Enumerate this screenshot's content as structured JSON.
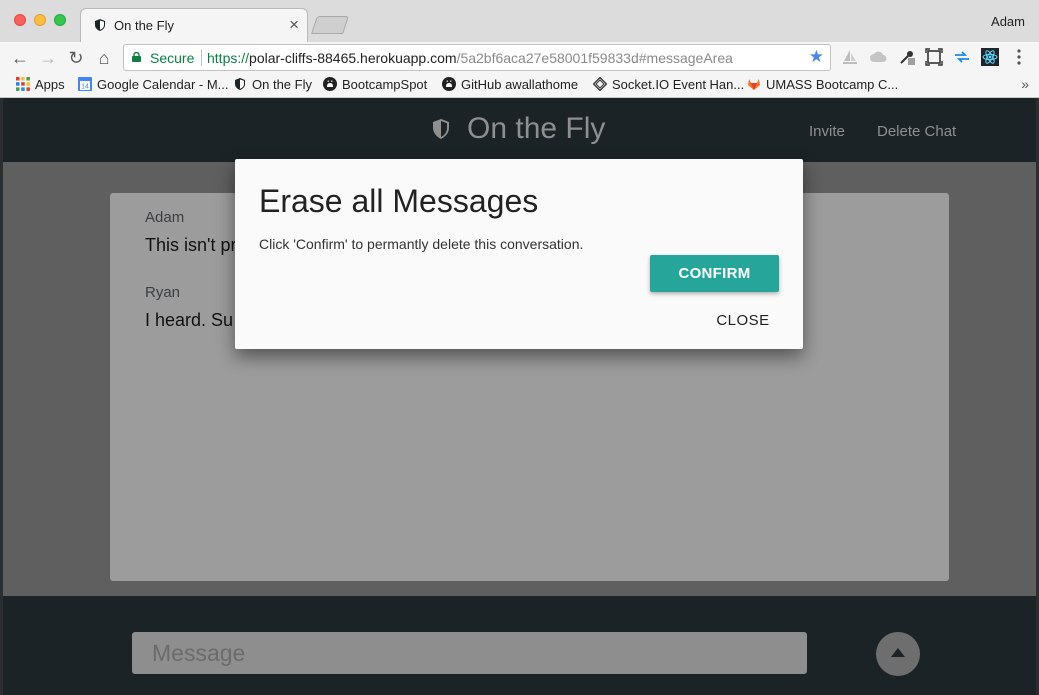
{
  "browser": {
    "tab": {
      "title": "On the Fly",
      "close_glyph": "×"
    },
    "profile_name": "Adam",
    "nav": {
      "back": "←",
      "forward": "→",
      "reload": "↻",
      "home": "⌂"
    },
    "omnibox": {
      "secure_label": "Secure",
      "url_protocol": "https://",
      "url_host": "polar-cliffs-88465.herokuapp.com",
      "url_path": "/5a2bf6aca27e58001f59833d#messageArea",
      "bookmark_star": "★"
    },
    "bookmarks": [
      {
        "label": "Apps",
        "icon": "apps-grid-icon"
      },
      {
        "label": "Google Calendar - M...",
        "icon": "calendar-icon"
      },
      {
        "label": "On the Fly",
        "icon": "shield-icon"
      },
      {
        "label": "BootcampSpot",
        "icon": "github-icon"
      },
      {
        "label": "GitHub awallathome",
        "icon": "github-icon"
      },
      {
        "label": "Socket.IO Event Han...",
        "icon": "socketio-icon"
      },
      {
        "label": "UMASS Bootcamp C...",
        "icon": "gitlab-icon"
      }
    ],
    "bookmarks_more": "»",
    "calendar_icon_number": "14"
  },
  "app": {
    "brand_title": "On the Fly",
    "nav": {
      "invite": "Invite",
      "delete_chat": "Delete Chat"
    },
    "messages": [
      {
        "author": "Adam",
        "text": "This isn't pr"
      },
      {
        "author": "Ryan",
        "text": "I heard. Su"
      }
    ],
    "composer": {
      "placeholder": "Message"
    }
  },
  "modal": {
    "title": "Erase all Messages",
    "body": "Click 'Confirm' to permantly delete this conversation.",
    "confirm_label": "CONFIRM",
    "close_label": "CLOSE"
  },
  "colors": {
    "accent": "#26a69a",
    "app_background": "#1b2326",
    "secure_green": "#0b8043"
  }
}
